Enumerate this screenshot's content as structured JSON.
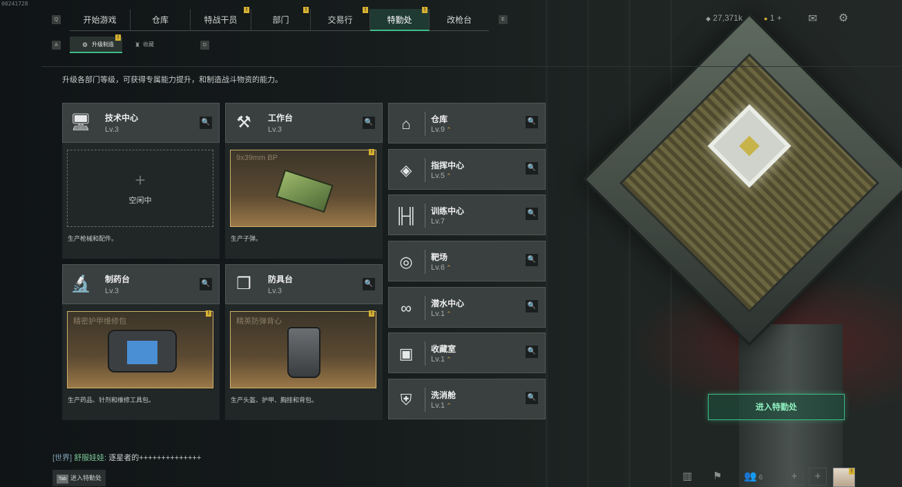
{
  "corner_id": "00241728",
  "nav": {
    "left_key": "Q",
    "right_key": "E",
    "tabs": [
      {
        "label": "开始游戏",
        "badge": ""
      },
      {
        "label": "仓库",
        "badge": ""
      },
      {
        "label": "特战干员",
        "badge": "!"
      },
      {
        "label": "部门",
        "badge": "!"
      },
      {
        "label": "交易行",
        "badge": "!"
      },
      {
        "label": "特勤处",
        "badge": "!",
        "active": true
      },
      {
        "label": "改枪台",
        "badge": ""
      }
    ]
  },
  "subnav": {
    "left_key": "A",
    "right_key": "D",
    "tabs": [
      {
        "label": "升级制造",
        "badge": "!",
        "active": true
      },
      {
        "label": "收藏",
        "badge": ""
      }
    ]
  },
  "currency": {
    "amount": "27,371k",
    "tickets": "1",
    "plus": "+"
  },
  "description": "升级各部门等级，可获得专属能力提升，和制造战斗物资的能力。",
  "production": [
    {
      "name": "技术中心",
      "level": "Lv.3",
      "icon": "monitor-icon",
      "slot_state": "empty",
      "slot_plus": "+",
      "slot_text": "空闲中",
      "caption": "生产枪械和配件。"
    },
    {
      "name": "工作台",
      "level": "Lv.3",
      "icon": "hammer-wrench-icon",
      "slot_state": "item",
      "slot_text": "9x39mm BP",
      "caption": "生产子弹。"
    },
    {
      "name": "制药台",
      "level": "Lv.3",
      "icon": "microscope-icon",
      "slot_state": "item",
      "slot_text": "精密护甲维修包",
      "caption": "生产药品、针剂和维修工具包。"
    },
    {
      "name": "防具台",
      "level": "Lv.3",
      "icon": "cubes-icon",
      "slot_state": "item",
      "slot_text": "精英防弹背心",
      "caption": "生产头盔、护甲、胸挂和背包。"
    }
  ],
  "departments": [
    {
      "name": "仓库",
      "level": "Lv.9",
      "upgradable": true,
      "icon": "warehouse-icon"
    },
    {
      "name": "指挥中心",
      "level": "Lv.5",
      "upgradable": true,
      "icon": "command-diamond-icon"
    },
    {
      "name": "训练中心",
      "level": "Lv.7",
      "upgradable": false,
      "icon": "dumbbell-icon"
    },
    {
      "name": "靶场",
      "level": "Lv.6",
      "upgradable": true,
      "icon": "target-icon"
    },
    {
      "name": "潜水中心",
      "level": "Lv.1",
      "upgradable": true,
      "icon": "goggles-icon"
    },
    {
      "name": "收藏室",
      "level": "Lv.1",
      "upgradable": true,
      "icon": "vault-icon"
    },
    {
      "name": "洗消舱",
      "level": "Lv.1",
      "upgradable": true,
      "icon": "decon-icon"
    }
  ],
  "enter_button": "进入特勤处",
  "chat": {
    "channel": "[世界]",
    "name": "舒服娃娃:",
    "message": "逐星者的++++++++++++++"
  },
  "tab_hint": {
    "key": "Tab",
    "label": "进入特勤处"
  },
  "bottom": {
    "friends_count": "6"
  },
  "colors": {
    "accent": "#3fbf8a",
    "badge": "#d8b233",
    "item_border": "#d3b36b"
  }
}
